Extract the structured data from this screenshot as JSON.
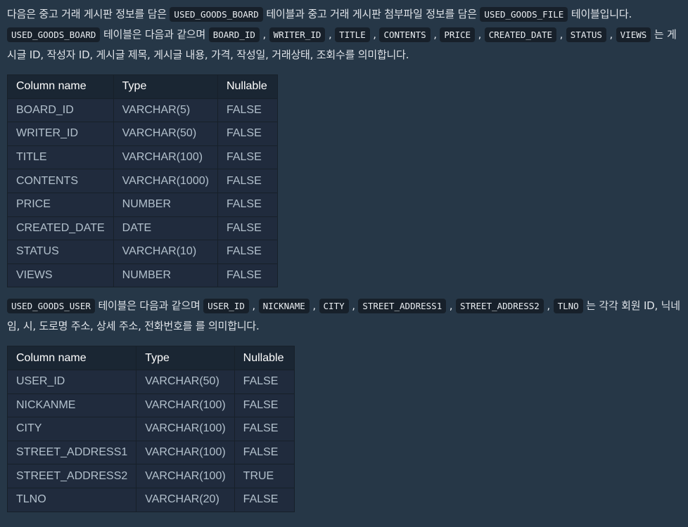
{
  "intro": {
    "s1": "다음은 중고 거래 게시판 정보를 담은 ",
    "c1": "USED_GOODS_BOARD",
    "s2": " 테이블과 중고 거래 게시판 첨부파일 정보를 담은 ",
    "c2": "USED_GOODS_FILE",
    "s3": " 테이블입니다. ",
    "c3": "USED_GOODS_BOARD",
    "s4": " 테이블은 다음과 같으며 ",
    "cols": [
      "BOARD_ID",
      "WRITER_ID",
      "TITLE",
      "CONTENTS",
      "PRICE",
      "CREATED_DATE",
      "STATUS",
      "VIEWS"
    ],
    "s5": " 는 게시글 ID, 작성자 ID, 게시글 제목, 게시글 내용, 가격, 작성일, 거래상태, 조회수를 의미합니다."
  },
  "board_table": {
    "headers": [
      "Column name",
      "Type",
      "Nullable"
    ],
    "rows": [
      [
        "BOARD_ID",
        "VARCHAR(5)",
        "FALSE"
      ],
      [
        "WRITER_ID",
        "VARCHAR(50)",
        "FALSE"
      ],
      [
        "TITLE",
        "VARCHAR(100)",
        "FALSE"
      ],
      [
        "CONTENTS",
        "VARCHAR(1000)",
        "FALSE"
      ],
      [
        "PRICE",
        "NUMBER",
        "FALSE"
      ],
      [
        "CREATED_DATE",
        "DATE",
        "FALSE"
      ],
      [
        "STATUS",
        "VARCHAR(10)",
        "FALSE"
      ],
      [
        "VIEWS",
        "NUMBER",
        "FALSE"
      ]
    ]
  },
  "user_intro": {
    "c1": "USED_GOODS_USER",
    "s1": " 테이블은 다음과 같으며 ",
    "cols": [
      "USER_ID",
      "NICKNAME",
      "CITY",
      "STREET_ADDRESS1",
      "STREET_ADDRESS2",
      "TLNO"
    ],
    "s2": " 는 각각 회원 ID, 닉네임, 시, 도로명 주소, 상세 주소, 전화번호를 를 의미합니다."
  },
  "user_table": {
    "headers": [
      "Column name",
      "Type",
      "Nullable"
    ],
    "rows": [
      [
        "USER_ID",
        "VARCHAR(50)",
        "FALSE"
      ],
      [
        "NICKANME",
        "VARCHAR(100)",
        "FALSE"
      ],
      [
        "CITY",
        "VARCHAR(100)",
        "FALSE"
      ],
      [
        "STREET_ADDRESS1",
        "VARCHAR(100)",
        "FALSE"
      ],
      [
        "STREET_ADDRESS2",
        "VARCHAR(100)",
        "TRUE"
      ],
      [
        "TLNO",
        "VARCHAR(20)",
        "FALSE"
      ]
    ]
  }
}
